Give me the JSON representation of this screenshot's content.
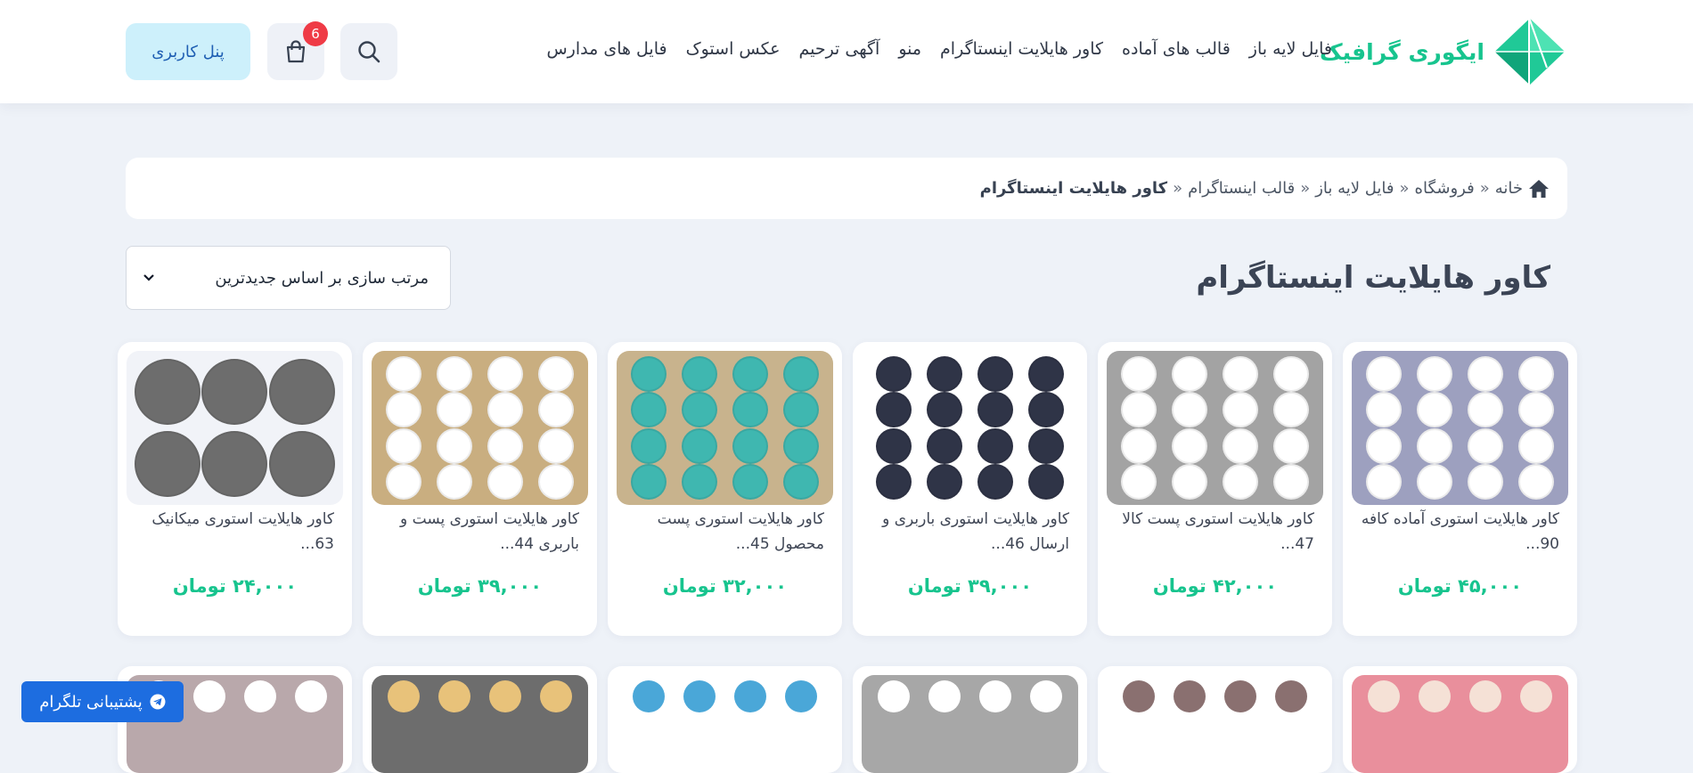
{
  "header": {
    "logo_text": "ایگوری گرافیک",
    "nav": [
      "فایل لایه باز",
      "قالب های آماده",
      "کاور هایلایت اینستاگرام",
      "منو",
      "آگهی ترحیم",
      "عکس استوک",
      "فایل های مدارس"
    ],
    "cart_count": "6",
    "panel_label": "پنل کاربری"
  },
  "breadcrumb": {
    "items": [
      "خانه",
      "فروشگاه",
      "فایل لایه باز",
      "قالب اینستاگرام"
    ],
    "separator": "»",
    "current": "کاور هایلایت اینستاگرام"
  },
  "page": {
    "title": "کاور هایلایت اینستاگرام",
    "sort_label": "مرتب سازی بر اساس جدیدترین"
  },
  "products": [
    {
      "title": "کاور هایلایت استوری آماده کافه 90...",
      "price": "۴۵,۰۰۰ تومان",
      "bg": "#9da0bf",
      "dot": "#ffffff",
      "layout": "4x4"
    },
    {
      "title": "کاور هایلایت استوری پست کالا 47...",
      "price": "۴۲,۰۰۰ تومان",
      "bg": "#a3a3a3",
      "dot": "#ffffff",
      "layout": "4x4"
    },
    {
      "title": "کاور هایلایت استوری باربری و ارسال 46...",
      "price": "۳۹,۰۰۰ تومان",
      "bg": "#ffffff",
      "dot": "#2f3447",
      "layout": "4x4"
    },
    {
      "title": "کاور هایلایت استوری پست محصول 45...",
      "price": "۳۲,۰۰۰ تومان",
      "bg": "#c8b38d",
      "dot": "#3fb7b0",
      "layout": "4x4"
    },
    {
      "title": "کاور هایلایت استوری پست و باربری 44...",
      "price": "۳۹,۰۰۰ تومان",
      "bg": "#c9ae80",
      "dot": "#ffffff",
      "layout": "4x4"
    },
    {
      "title": "کاور هایلایت استوری میکانیک 63...",
      "price": "۲۴,۰۰۰ تومان",
      "bg": "#f1f3f8",
      "dot": "#6d6d6d",
      "layout": "3x2"
    }
  ],
  "products_row2": [
    {
      "bg": "#e98f9c",
      "dot": "#f5e1d6"
    },
    {
      "bg": "#ffffff",
      "dot": "#8a7070"
    },
    {
      "bg": "#a7a7a7",
      "dot": "#ffffff"
    },
    {
      "bg": "#ffffff",
      "dot": "#4aa7d8"
    },
    {
      "bg": "#6d6d6d",
      "dot": "#e8c27a"
    },
    {
      "bg": "#b9a8ab",
      "dot": "#ffffff"
    }
  ],
  "support": {
    "label": "پشتیبانی تلگرام"
  },
  "colors": {
    "accent": "#17c48e",
    "page_bg": "#eef2f8",
    "badge": "#ef3b46",
    "panel_bg": "#cdf0fb",
    "support_bg": "#1d6de0"
  }
}
